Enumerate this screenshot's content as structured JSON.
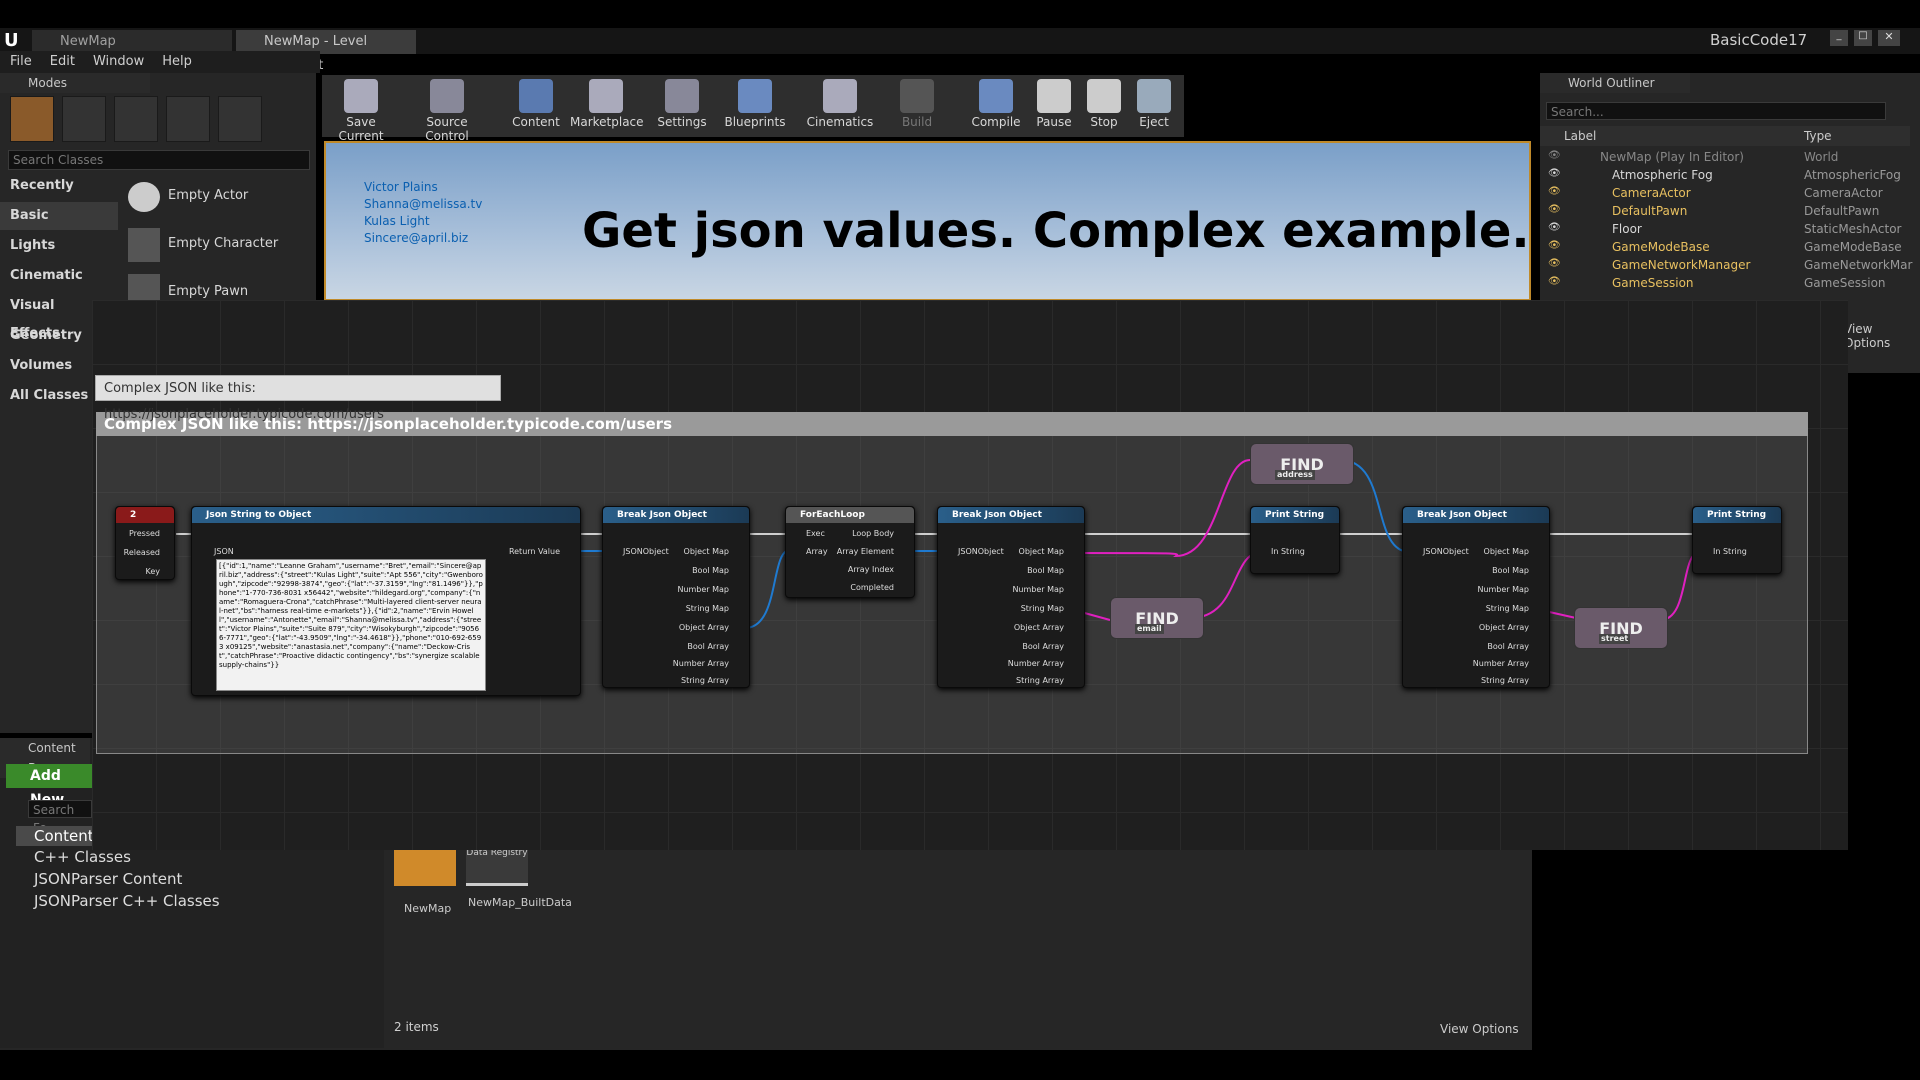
{
  "tabs": [
    "NewMap",
    "NewMap - Level Blueprint"
  ],
  "window_user": "BasicCode17",
  "menu": [
    "File",
    "Edit",
    "Window",
    "Help"
  ],
  "modes": {
    "title": "Modes",
    "search_placeholder": "Search Classes",
    "categories": [
      "Recently Placed",
      "Basic",
      "Lights",
      "Cinematic",
      "Visual Effects",
      "Geometry",
      "Volumes",
      "All Classes"
    ],
    "items": [
      "Empty Actor",
      "Empty Character",
      "Empty Pawn"
    ]
  },
  "toolbar": [
    "Save Current",
    "Source Control",
    "Content",
    "Marketplace",
    "Settings",
    "Blueprints",
    "Cinematics",
    "Build",
    "Compile",
    "Pause",
    "Stop",
    "Eject"
  ],
  "viewport": {
    "names": [
      "Victor Plains",
      "Shanna@melissa.tv",
      "Kulas Light",
      "Sincere@april.biz"
    ],
    "headline": "Get json values. Complex example."
  },
  "outliner": {
    "title": "World Outliner",
    "search_placeholder": "Search...",
    "col_label": "Label",
    "col_type": "Type",
    "rows": [
      [
        "NewMap (Play In Editor)",
        "World"
      ],
      [
        "Atmospheric Fog",
        "AtmosphericFog"
      ],
      [
        "CameraActor",
        "CameraActor"
      ],
      [
        "DefaultPawn",
        "DefaultPawn"
      ],
      [
        "Floor",
        "StaticMeshActor"
      ],
      [
        "GameModeBase",
        "GameModeBase"
      ],
      [
        "GameNetworkManager",
        "GameNetworkMar"
      ],
      [
        "GameSession",
        "GameSession"
      ]
    ],
    "view_options": "View Options"
  },
  "blueprint": {
    "tooltip": "Complex JSON like this: https://jsonplaceholder.typicode.com/users",
    "comment": "Complex JSON like this: https://jsonplaceholder.typicode.com/users",
    "key_node": "2",
    "key_pins": [
      "Pressed",
      "Released",
      "Key"
    ],
    "json_node": "Json String to Object",
    "json_label": "JSON",
    "return_value": "Return Value",
    "json_text": "[{\"id\":1,\"name\":\"Leanne Graham\",\"username\":\"Bret\",\"email\":\"Sincere@april.biz\",\"address\":{\"street\":\"Kulas Light\",\"suite\":\"Apt 556\",\"city\":\"Gwenborough\",\"zipcode\":\"92998-3874\",\"geo\":{\"lat\":\"-37.3159\",\"lng\":\"81.1496\"}},\"phone\":\"1-770-736-8031 x56442\",\"website\":\"hildegard.org\",\"company\":{\"name\":\"Romaguera-Crona\",\"catchPhrase\":\"Multi-layered client-server neural-net\",\"bs\":\"harness real-time e-markets\"}},{\"id\":2,\"name\":\"Ervin Howell\",\"username\":\"Antonette\",\"email\":\"Shanna@melissa.tv\",\"address\":{\"street\":\"Victor Plains\",\"suite\":\"Suite 879\",\"city\":\"Wisokyburgh\",\"zipcode\":\"90566-7771\",\"geo\":{\"lat\":\"-43.9509\",\"lng\":\"-34.4618\"}},\"phone\":\"010-692-6593 x09125\",\"website\":\"anastasia.net\",\"company\":{\"name\":\"Deckow-Crist\",\"catchPhrase\":\"Proactive didactic contingency\",\"bs\":\"synergize scalable supply-chains\"}}",
    "break_node": "Break Json Object",
    "jsonobject": "JSONObject",
    "break_pins": [
      "Object Map",
      "Bool Map",
      "Number Map",
      "String Map",
      "Object Array",
      "Bool Array",
      "Number Array",
      "String Array"
    ],
    "foreach": "ForEachLoop",
    "foreach_pins": [
      "Exec",
      "Array",
      "Loop Body",
      "Array Element",
      "Array Index",
      "Completed"
    ],
    "print": "Print String",
    "in_string": "In String",
    "find": "FIND",
    "find_keys": [
      "address",
      "email",
      "street"
    ]
  },
  "content_browser": {
    "title": "Content Br",
    "add_new": "Add New",
    "search": "Search Fo",
    "tree": [
      "Content",
      "C++ Classes",
      "JSONParser Content",
      "JSONParser C++ Classes"
    ],
    "assets": [
      "NewMap",
      "NewMap_BuiltData"
    ],
    "asset_badge": "Data Registry",
    "count": "2 items",
    "view_options": "View Options"
  }
}
